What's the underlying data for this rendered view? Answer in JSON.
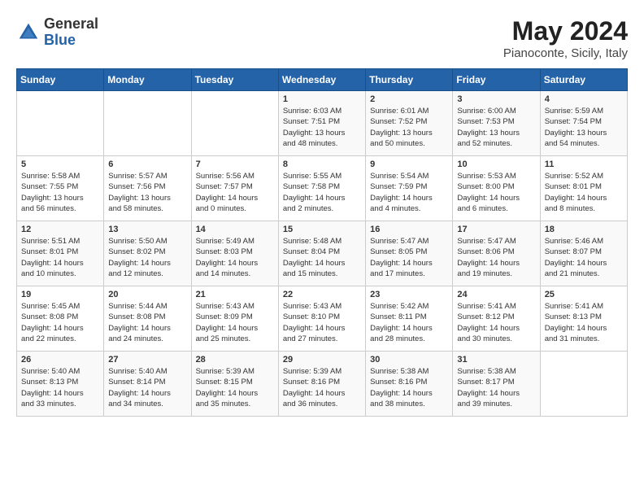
{
  "logo": {
    "general": "General",
    "blue": "Blue"
  },
  "header": {
    "month": "May 2024",
    "location": "Pianoconte, Sicily, Italy"
  },
  "weekdays": [
    "Sunday",
    "Monday",
    "Tuesday",
    "Wednesday",
    "Thursday",
    "Friday",
    "Saturday"
  ],
  "weeks": [
    [
      {
        "day": "",
        "info": ""
      },
      {
        "day": "",
        "info": ""
      },
      {
        "day": "",
        "info": ""
      },
      {
        "day": "1",
        "info": "Sunrise: 6:03 AM\nSunset: 7:51 PM\nDaylight: 13 hours\nand 48 minutes."
      },
      {
        "day": "2",
        "info": "Sunrise: 6:01 AM\nSunset: 7:52 PM\nDaylight: 13 hours\nand 50 minutes."
      },
      {
        "day": "3",
        "info": "Sunrise: 6:00 AM\nSunset: 7:53 PM\nDaylight: 13 hours\nand 52 minutes."
      },
      {
        "day": "4",
        "info": "Sunrise: 5:59 AM\nSunset: 7:54 PM\nDaylight: 13 hours\nand 54 minutes."
      }
    ],
    [
      {
        "day": "5",
        "info": "Sunrise: 5:58 AM\nSunset: 7:55 PM\nDaylight: 13 hours\nand 56 minutes."
      },
      {
        "day": "6",
        "info": "Sunrise: 5:57 AM\nSunset: 7:56 PM\nDaylight: 13 hours\nand 58 minutes."
      },
      {
        "day": "7",
        "info": "Sunrise: 5:56 AM\nSunset: 7:57 PM\nDaylight: 14 hours\nand 0 minutes."
      },
      {
        "day": "8",
        "info": "Sunrise: 5:55 AM\nSunset: 7:58 PM\nDaylight: 14 hours\nand 2 minutes."
      },
      {
        "day": "9",
        "info": "Sunrise: 5:54 AM\nSunset: 7:59 PM\nDaylight: 14 hours\nand 4 minutes."
      },
      {
        "day": "10",
        "info": "Sunrise: 5:53 AM\nSunset: 8:00 PM\nDaylight: 14 hours\nand 6 minutes."
      },
      {
        "day": "11",
        "info": "Sunrise: 5:52 AM\nSunset: 8:01 PM\nDaylight: 14 hours\nand 8 minutes."
      }
    ],
    [
      {
        "day": "12",
        "info": "Sunrise: 5:51 AM\nSunset: 8:01 PM\nDaylight: 14 hours\nand 10 minutes."
      },
      {
        "day": "13",
        "info": "Sunrise: 5:50 AM\nSunset: 8:02 PM\nDaylight: 14 hours\nand 12 minutes."
      },
      {
        "day": "14",
        "info": "Sunrise: 5:49 AM\nSunset: 8:03 PM\nDaylight: 14 hours\nand 14 minutes."
      },
      {
        "day": "15",
        "info": "Sunrise: 5:48 AM\nSunset: 8:04 PM\nDaylight: 14 hours\nand 15 minutes."
      },
      {
        "day": "16",
        "info": "Sunrise: 5:47 AM\nSunset: 8:05 PM\nDaylight: 14 hours\nand 17 minutes."
      },
      {
        "day": "17",
        "info": "Sunrise: 5:47 AM\nSunset: 8:06 PM\nDaylight: 14 hours\nand 19 minutes."
      },
      {
        "day": "18",
        "info": "Sunrise: 5:46 AM\nSunset: 8:07 PM\nDaylight: 14 hours\nand 21 minutes."
      }
    ],
    [
      {
        "day": "19",
        "info": "Sunrise: 5:45 AM\nSunset: 8:08 PM\nDaylight: 14 hours\nand 22 minutes."
      },
      {
        "day": "20",
        "info": "Sunrise: 5:44 AM\nSunset: 8:08 PM\nDaylight: 14 hours\nand 24 minutes."
      },
      {
        "day": "21",
        "info": "Sunrise: 5:43 AM\nSunset: 8:09 PM\nDaylight: 14 hours\nand 25 minutes."
      },
      {
        "day": "22",
        "info": "Sunrise: 5:43 AM\nSunset: 8:10 PM\nDaylight: 14 hours\nand 27 minutes."
      },
      {
        "day": "23",
        "info": "Sunrise: 5:42 AM\nSunset: 8:11 PM\nDaylight: 14 hours\nand 28 minutes."
      },
      {
        "day": "24",
        "info": "Sunrise: 5:41 AM\nSunset: 8:12 PM\nDaylight: 14 hours\nand 30 minutes."
      },
      {
        "day": "25",
        "info": "Sunrise: 5:41 AM\nSunset: 8:13 PM\nDaylight: 14 hours\nand 31 minutes."
      }
    ],
    [
      {
        "day": "26",
        "info": "Sunrise: 5:40 AM\nSunset: 8:13 PM\nDaylight: 14 hours\nand 33 minutes."
      },
      {
        "day": "27",
        "info": "Sunrise: 5:40 AM\nSunset: 8:14 PM\nDaylight: 14 hours\nand 34 minutes."
      },
      {
        "day": "28",
        "info": "Sunrise: 5:39 AM\nSunset: 8:15 PM\nDaylight: 14 hours\nand 35 minutes."
      },
      {
        "day": "29",
        "info": "Sunrise: 5:39 AM\nSunset: 8:16 PM\nDaylight: 14 hours\nand 36 minutes."
      },
      {
        "day": "30",
        "info": "Sunrise: 5:38 AM\nSunset: 8:16 PM\nDaylight: 14 hours\nand 38 minutes."
      },
      {
        "day": "31",
        "info": "Sunrise: 5:38 AM\nSunset: 8:17 PM\nDaylight: 14 hours\nand 39 minutes."
      },
      {
        "day": "",
        "info": ""
      }
    ]
  ]
}
